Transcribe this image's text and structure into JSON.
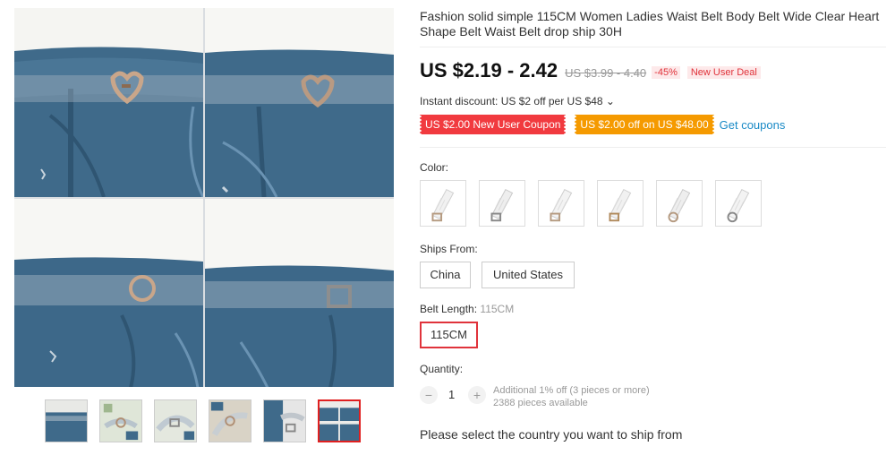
{
  "product": {
    "title": "Fashion solid simple 115CM Women Ladies Waist Belt Body Belt Wide Clear Heart Shape Belt Waist Belt drop ship 30H"
  },
  "price": {
    "current": "US $2.19 - 2.42",
    "original": "US $3.99 - 4.40",
    "discount": "-45%",
    "deal_badge": "New User Deal"
  },
  "instant_discount": "Instant discount: US $2 off per US $48 ⌄",
  "coupons": {
    "items": [
      "US $2.00 New User Coupon",
      "US $2.00 off on US $48.00"
    ],
    "get_label": "Get coupons"
  },
  "color": {
    "label": "Color:",
    "swatch_count": 6
  },
  "ships_from": {
    "label": "Ships From:",
    "options": [
      "China",
      "United States"
    ]
  },
  "belt_length": {
    "label": "Belt Length:",
    "selected": "115CM",
    "options": [
      "115CM"
    ]
  },
  "quantity": {
    "label": "Quantity:",
    "minus": "−",
    "value": "1",
    "plus": "+",
    "additional": "Additional 1% off (3 pieces or more)",
    "available": "2388 pieces available"
  },
  "ship_message": "Please select the country you want to ship from",
  "gallery": {
    "thumbnail_count": 6,
    "active_thumbnail": 6
  },
  "colors": {
    "price_red": "#e0333b",
    "coupon_red": "#f13a3f",
    "coupon_orange": "#f59a00",
    "link_blue": "#1a8ac6",
    "denim": "#3f6a8a"
  }
}
